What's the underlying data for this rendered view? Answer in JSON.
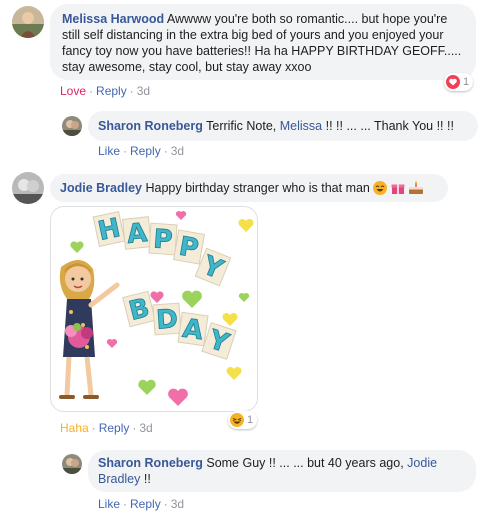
{
  "comments": [
    {
      "author": "Melissa Harwood",
      "text": "Awwww you're both so romantic.... but hope you're still self distancing in the extra big bed of yours and you enjoyed your fancy toy now you have batteries!! Ha ha HAPPY BIRTHDAY GEOFF..... stay awesome, stay cool, but stay away xxoo",
      "reaction_label": "Love",
      "reply_label": "Reply",
      "time": "3d",
      "reaction_count": "1"
    },
    {
      "author": "Sharon Roneberg",
      "text_before": "Terrific Note,",
      "mention": "Melissa",
      "text_after": "!! !! ... ... Thank You !! !!",
      "like_label": "Like",
      "reply_label": "Reply",
      "time": "3d"
    },
    {
      "author": "Jodie Bradley",
      "text": "Happy birthday stranger who is that man",
      "reaction_label": "Haha",
      "reply_label": "Reply",
      "time": "3d",
      "reaction_count": "1",
      "sticker_letters": [
        "H",
        "A",
        "P",
        "P",
        "Y",
        "B",
        "D",
        "A",
        "Y"
      ]
    },
    {
      "author": "Sharon Roneberg",
      "text_before": "Some Guy !! ... ... but 40 years ago,",
      "mention_line1": "Jodie",
      "mention_line2": "Bradley",
      "text_after": "!!",
      "like_label": "Like",
      "reply_label": "Reply",
      "time": "3d"
    }
  ],
  "colors": {
    "link": "#385898",
    "love": "#e0245e",
    "haha": "#f7b125",
    "bubble": "#f2f3f5",
    "sticker_letter": "#3fb6c9"
  }
}
